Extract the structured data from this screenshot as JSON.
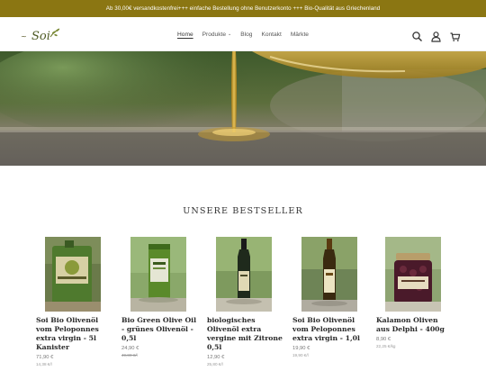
{
  "announcement": "Ab 30,00€ versandkostenfrei+++ einfache Bestellung ohne Benutzerkonto +++ Bio-Qualität aus Griechenland",
  "logo": {
    "text": "Soi"
  },
  "nav": [
    {
      "label": "Home",
      "active": true
    },
    {
      "label": "Produkte",
      "has_dropdown": true
    },
    {
      "label": "Blog"
    },
    {
      "label": "Kontakt"
    },
    {
      "label": "Märkte"
    }
  ],
  "header_icons": [
    "search-icon",
    "account-icon",
    "cart-icon"
  ],
  "section_title": "UNSERE BESTSELLER",
  "products": [
    {
      "title": "Soi Bio Olivenöl vom Peloponnes extra virgin - 5l Kanister",
      "price": "71,90 €",
      "unit_price": "14,38 €/l"
    },
    {
      "title": "Bio Green Olive Oil - grünes Olivenöl - 0,5l",
      "price": "24,90 €",
      "old_price": "49,80 €/l"
    },
    {
      "title": "biologisches Olivenöl extra vergine mit Zitrone 0,5l",
      "price": "12,90 €",
      "unit_price": "25,80 €/l"
    },
    {
      "title": "Soi Bio Olivenöl vom Peloponnes extra virgin - 1,0l",
      "price": "19,90 €",
      "unit_price": "19,90 €/l"
    },
    {
      "title": "Kalamon Oliven aus Delphi - 400g",
      "price": "8,90 €",
      "unit_price": "22,25 €/kg"
    }
  ],
  "colors": {
    "announcement_bg": "#8b7612",
    "text": "#2a2a2a"
  }
}
